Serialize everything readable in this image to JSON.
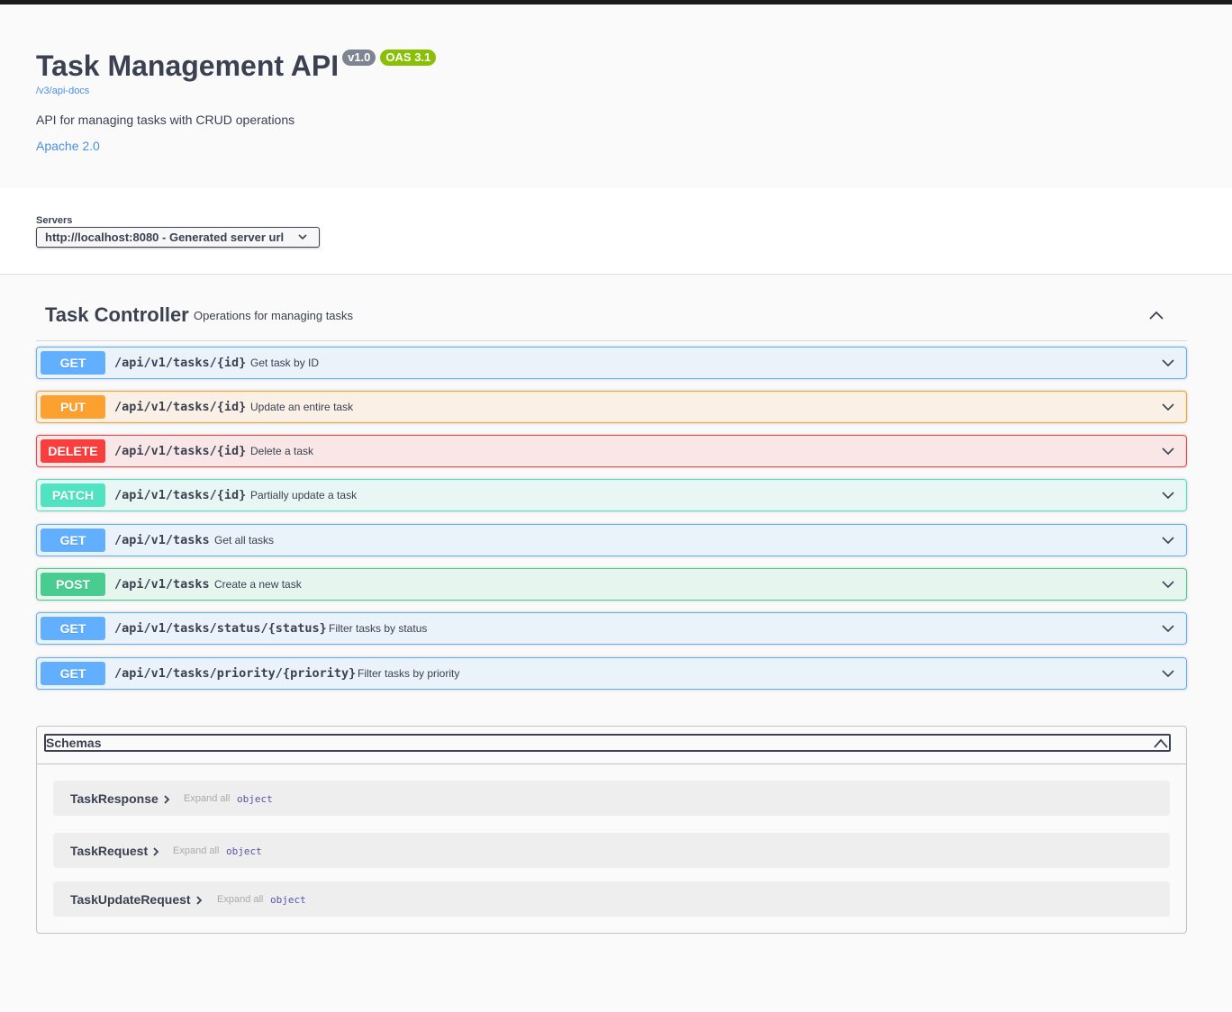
{
  "info": {
    "title": "Task Management API",
    "version": "v1.0",
    "oas": "OAS 3.1",
    "docs_link": "/v3/api-docs",
    "description": "API for managing tasks with CRUD operations",
    "license": "Apache 2.0"
  },
  "servers": {
    "label": "Servers",
    "selected": "http://localhost:8080 - Generated server url"
  },
  "controller": {
    "name": "Task Controller",
    "description": "Operations for managing tasks",
    "operations": [
      {
        "method": "GET",
        "path": "/api/v1/tasks/{id}",
        "summary": "Get task by ID"
      },
      {
        "method": "PUT",
        "path": "/api/v1/tasks/{id}",
        "summary": "Update an entire task"
      },
      {
        "method": "DELETE",
        "path": "/api/v1/tasks/{id}",
        "summary": "Delete a task"
      },
      {
        "method": "PATCH",
        "path": "/api/v1/tasks/{id}",
        "summary": "Partially update a task"
      },
      {
        "method": "GET",
        "path": "/api/v1/tasks",
        "summary": "Get all tasks"
      },
      {
        "method": "POST",
        "path": "/api/v1/tasks",
        "summary": "Create a new task"
      },
      {
        "method": "GET",
        "path": "/api/v1/tasks/status/{status}",
        "summary": "Filter tasks by status"
      },
      {
        "method": "GET",
        "path": "/api/v1/tasks/priority/{priority}",
        "summary": "Filter tasks by priority"
      }
    ]
  },
  "schemas": {
    "title": "Schemas",
    "models": [
      {
        "name": "TaskResponse",
        "expand": "Expand all",
        "type": "object"
      },
      {
        "name": "TaskRequest",
        "expand": "Expand all",
        "type": "object"
      },
      {
        "name": "TaskUpdateRequest",
        "expand": "Expand all",
        "type": "object"
      }
    ]
  },
  "colors": {
    "get": "#61affe",
    "put": "#fca130",
    "delete": "#f93e3e",
    "patch": "#50e3c2",
    "post": "#49cc90",
    "version_badge": "#7d8492",
    "oas_badge": "#89bf04",
    "link": "#4990e2"
  }
}
